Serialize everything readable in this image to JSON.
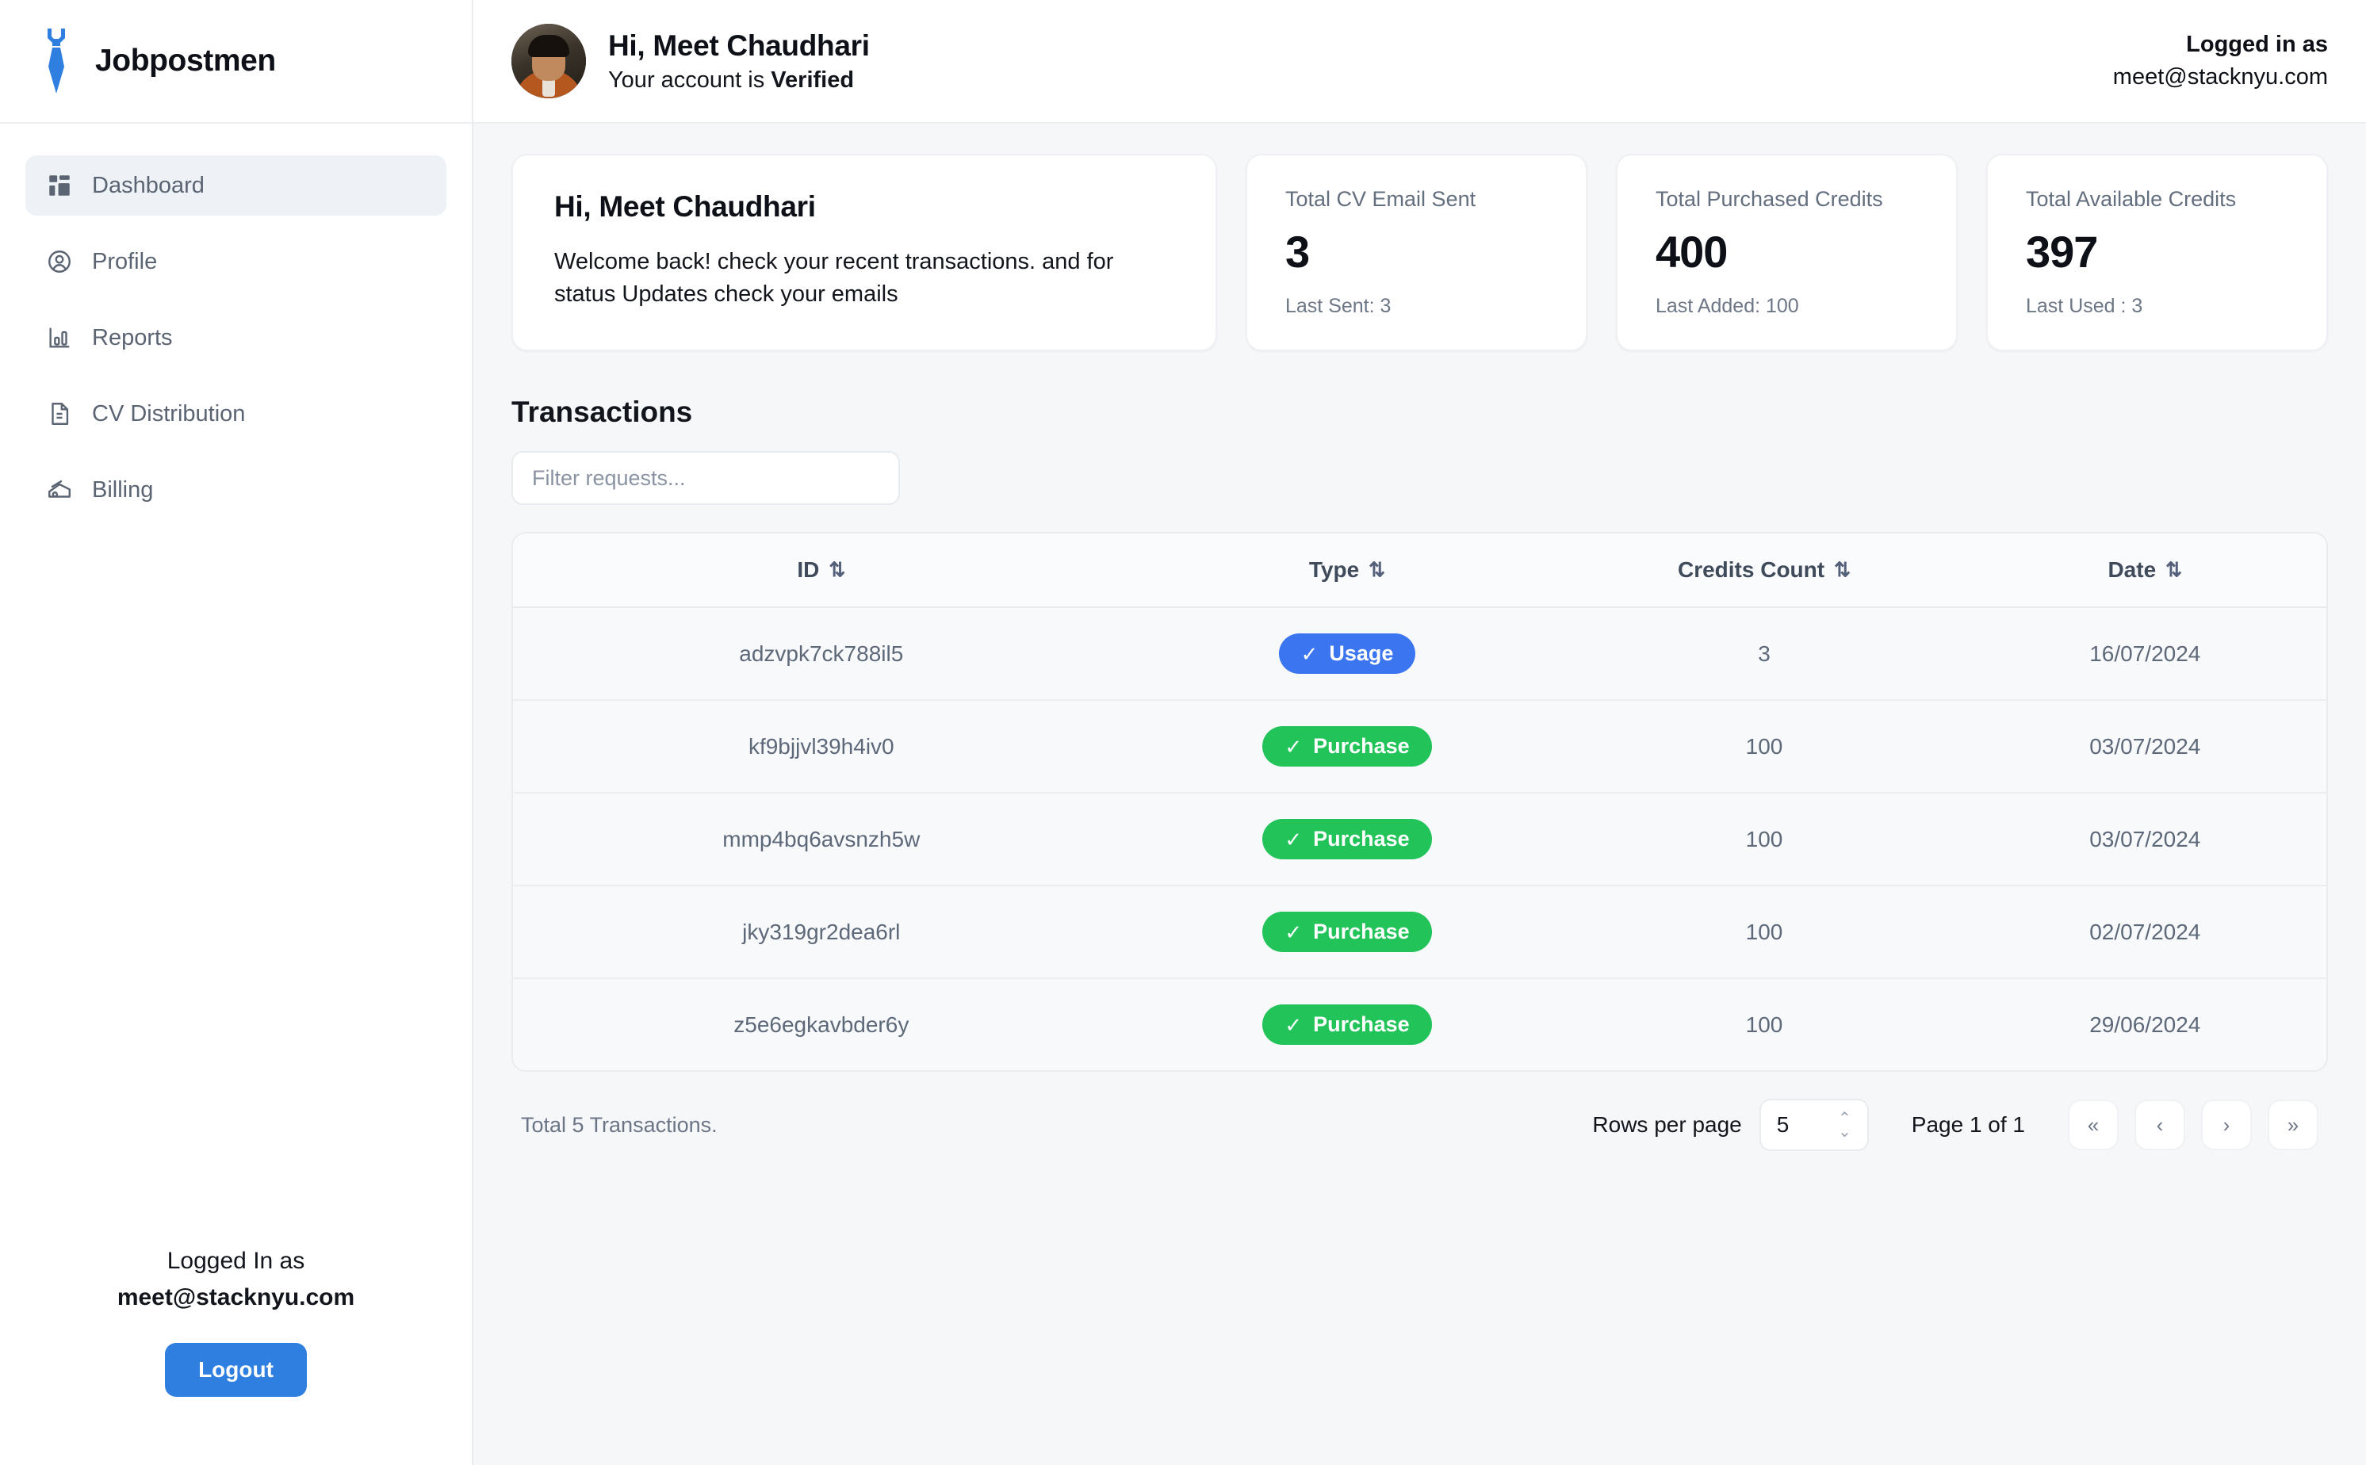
{
  "brand": {
    "name": "Jobpostmen",
    "logo_icon": "necktie-logo-icon",
    "accent_color": "#2f7fe0"
  },
  "sidebar": {
    "items": [
      {
        "label": "Dashboard",
        "icon": "dashboard-grid-icon",
        "active": true
      },
      {
        "label": "Profile",
        "icon": "user-circle-icon",
        "active": false
      },
      {
        "label": "Reports",
        "icon": "bar-chart-icon",
        "active": false
      },
      {
        "label": "CV Distribution",
        "icon": "document-text-icon",
        "active": false
      },
      {
        "label": "Billing",
        "icon": "money-bill-icon",
        "active": false
      }
    ],
    "footer": {
      "logged_in_label": "Logged In as",
      "email": "meet@stacknyu.com",
      "logout_label": "Logout"
    }
  },
  "topbar": {
    "avatar_icon": "user-avatar-photo",
    "greeting": "Hi, Meet Chaudhari",
    "status_prefix": "Your account is ",
    "status_value": "Verified",
    "logged_in_label": "Logged in as",
    "email": "meet@stacknyu.com"
  },
  "welcome_card": {
    "title": "Hi, Meet Chaudhari",
    "text": "Welcome back! check your recent transactions. and for status Updates check your emails"
  },
  "stats": [
    {
      "label": "Total CV Email Sent",
      "value": "3",
      "footnote": "Last Sent: 3"
    },
    {
      "label": "Total Purchased Credits",
      "value": "400",
      "footnote": "Last Added: 100"
    },
    {
      "label": "Total Available Credits",
      "value": "397",
      "footnote": "Last Used : 3"
    }
  ],
  "transactions": {
    "section_title": "Transactions",
    "filter_placeholder": "Filter requests...",
    "filter_value": "",
    "columns": [
      {
        "label": "ID",
        "sort_icon": "sort-updown-icon"
      },
      {
        "label": "Type",
        "sort_icon": "sort-updown-icon"
      },
      {
        "label": "Credits Count",
        "sort_icon": "sort-updown-icon"
      },
      {
        "label": "Date",
        "sort_icon": "sort-updown-icon"
      }
    ],
    "rows": [
      {
        "id": "adzvpk7ck788il5",
        "type": "Usage",
        "type_variant": "usage",
        "credits": "3",
        "date": "16/07/2024"
      },
      {
        "id": "kf9bjjvl39h4iv0",
        "type": "Purchase",
        "type_variant": "purchase",
        "credits": "100",
        "date": "03/07/2024"
      },
      {
        "id": "mmp4bq6avsnzh5w",
        "type": "Purchase",
        "type_variant": "purchase",
        "credits": "100",
        "date": "03/07/2024"
      },
      {
        "id": "jky319gr2dea6rl",
        "type": "Purchase",
        "type_variant": "purchase",
        "credits": "100",
        "date": "02/07/2024"
      },
      {
        "id": "z5e6egkavbder6y",
        "type": "Purchase",
        "type_variant": "purchase",
        "credits": "100",
        "date": "29/06/2024"
      }
    ],
    "badge_colors": {
      "usage": "#3b76f0",
      "purchase": "#22c45a"
    },
    "pagination": {
      "total_text": "Total 5 Transactions.",
      "rows_per_page_label": "Rows per page",
      "rows_per_page_value": "5",
      "page_text": "Page 1 of 1",
      "first_label": "«",
      "prev_label": "‹",
      "next_label": "›",
      "last_label": "»"
    }
  }
}
